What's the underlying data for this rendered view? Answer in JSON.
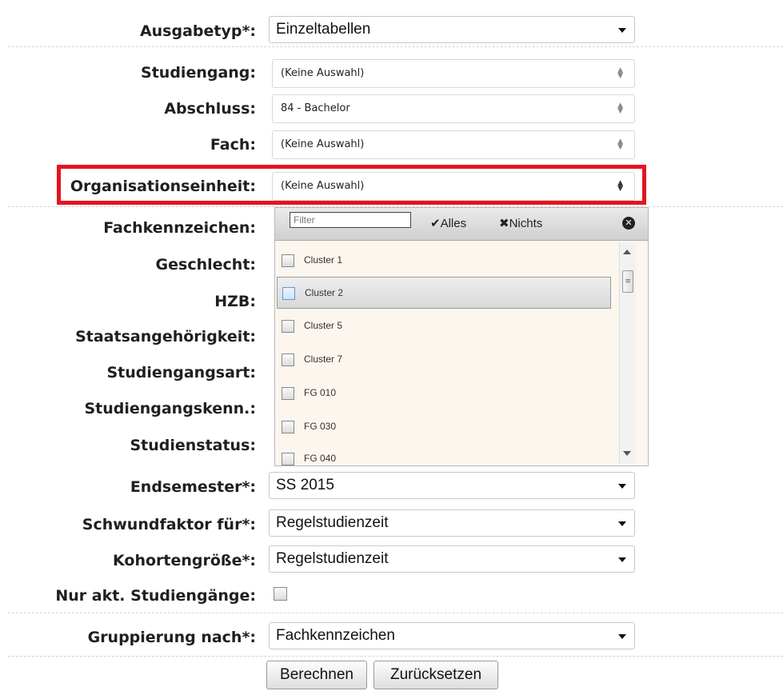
{
  "form": {
    "ausgabetyp": {
      "label": "Ausgabetyp*:",
      "value": "Einzeltabellen"
    },
    "studiengang": {
      "label": "Studiengang:",
      "value": "(Keine Auswahl)"
    },
    "abschluss": {
      "label": "Abschluss:",
      "value": "84 - Bachelor"
    },
    "fach": {
      "label": "Fach:",
      "value": "(Keine Auswahl)"
    },
    "organisationseinheit": {
      "label": "Organisationseinheit:",
      "value": "(Keine Auswahl)"
    },
    "fachkennzeichen": {
      "label": "Fachkennzeichen:"
    },
    "geschlecht": {
      "label": "Geschlecht:"
    },
    "hzb": {
      "label": "HZB:"
    },
    "staatsangehoerigkeit": {
      "label": "Staatsangehörigkeit:"
    },
    "studiengangsart": {
      "label": "Studiengangsart:"
    },
    "studiengangskenn": {
      "label": "Studiengangskenn.:"
    },
    "studienstatus": {
      "label": "Studienstatus:"
    },
    "endsemester": {
      "label": "Endsemester*:",
      "value": "SS 2015"
    },
    "schwundfaktor": {
      "label": "Schwundfaktor für*:",
      "value": "Regelstudienzeit"
    },
    "kohortengroesse": {
      "label": "Kohortengröße*:",
      "value": "Regelstudienzeit"
    },
    "nur_akt": {
      "label": "Nur akt. Studiengänge:",
      "checked": false
    },
    "gruppierung": {
      "label": "Gruppierung nach*:",
      "value": "Fachkennzeichen"
    }
  },
  "dropdown": {
    "filter_placeholder": "Filter",
    "select_all": "✔Alles",
    "select_none": "✖Nichts",
    "close_symbol": "✕",
    "options": [
      {
        "label": "Cluster 1",
        "checked": false
      },
      {
        "label": "Cluster 2",
        "checked": false,
        "hover": true
      },
      {
        "label": "Cluster 5",
        "checked": false
      },
      {
        "label": "Cluster 7",
        "checked": false
      },
      {
        "label": "FG 010",
        "checked": false
      },
      {
        "label": "FG 030",
        "checked": false
      },
      {
        "label": "FG 040",
        "checked": false
      }
    ]
  },
  "buttons": {
    "calculate": "Berechnen",
    "reset": "Zurücksetzen"
  },
  "colors": {
    "highlight": "#e4151f",
    "dropdown_bg": "#fdf6ee"
  }
}
